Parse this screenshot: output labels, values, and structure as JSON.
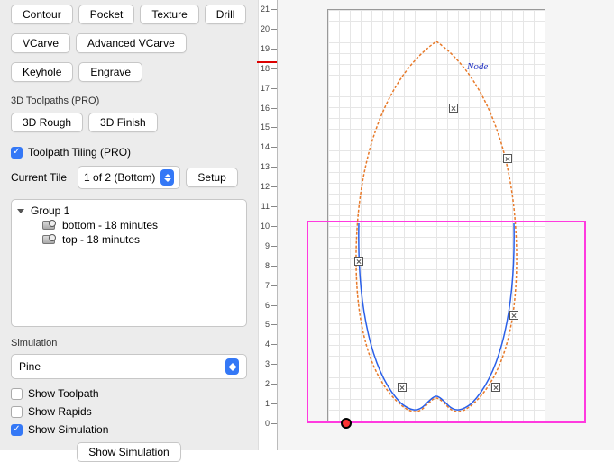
{
  "toolpaths": {
    "contour": "Contour",
    "pocket": "Pocket",
    "texture": "Texture",
    "drill": "Drill",
    "vcarve": "VCarve",
    "adv_vcarve": "Advanced VCarve",
    "keyhole": "Keyhole",
    "engrave": "Engrave"
  },
  "section_3d_label": "3D Toolpaths (PRO)",
  "toolpaths3d": {
    "rough": "3D Rough",
    "finish": "3D Finish"
  },
  "tiling": {
    "checkbox_label": "Toolpath Tiling (PRO)",
    "current_tile_label": "Current Tile",
    "current_tile_value": "1 of 2 (Bottom)",
    "setup": "Setup"
  },
  "tree": {
    "group": "Group 1",
    "item1": "bottom - 18 minutes",
    "item2": "top - 18 minutes"
  },
  "simulation": {
    "heading": "Simulation",
    "material": "Pine",
    "show_toolpath": "Show Toolpath",
    "show_rapids": "Show Rapids",
    "show_simulation_cb": "Show Simulation",
    "show_simulation_btn": "Show Simulation"
  },
  "canvas": {
    "node_label": "Node",
    "ruler_max": 21,
    "ruler_min": 0
  }
}
